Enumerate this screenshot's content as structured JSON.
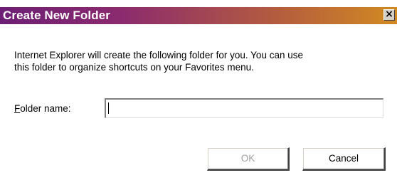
{
  "dialog": {
    "title": "Create New Folder",
    "close_glyph": "×",
    "close_icon": "close-icon",
    "message_line1": "Internet Explorer will create the following folder for you. You can use",
    "message_line2": "this folder to organize shortcuts on your Favorites menu.",
    "field_label_accel": "F",
    "field_label_rest": "older name:",
    "field_value": "",
    "ok_label": "OK",
    "cancel_label": "Cancel",
    "ok_enabled": false
  },
  "colors": {
    "titlebar_start": "#6d1f75",
    "titlebar_end": "#d18a22",
    "disabled_text": "#a0a0a0"
  }
}
